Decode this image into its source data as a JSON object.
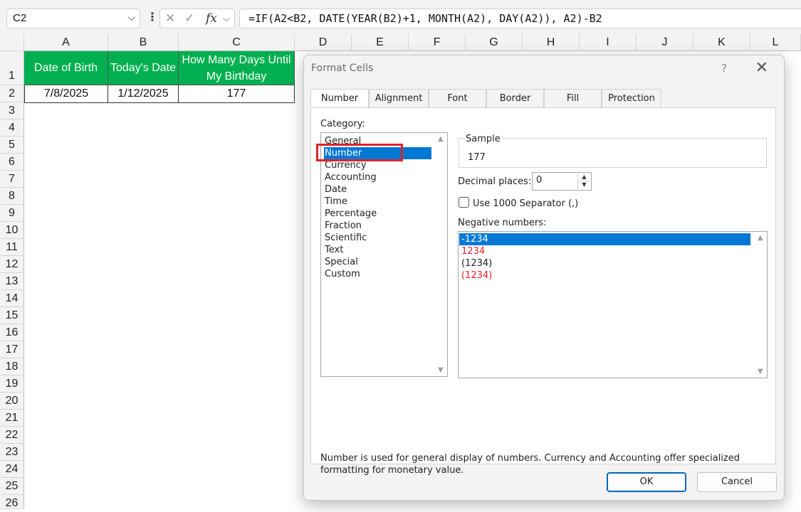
{
  "formula_bar": {
    "name_box": "C2",
    "formula": "=IF(A2<B2, DATE(YEAR(B2)+1, MONTH(A2), DAY(A2)), A2)-B2",
    "cancel_icon": "✕",
    "enter_icon": "✓",
    "fx_label": "fx"
  },
  "sheet": {
    "columns": [
      "A",
      "B",
      "C",
      "D",
      "E",
      "F",
      "G",
      "H",
      "I",
      "J",
      "K",
      "L"
    ],
    "rows": [
      "1",
      "2",
      "3",
      "4",
      "5",
      "6",
      "7",
      "8",
      "9",
      "10",
      "11",
      "12",
      "13",
      "14",
      "15",
      "16",
      "17",
      "18",
      "19",
      "20",
      "21",
      "22",
      "23",
      "24",
      "25",
      "26"
    ],
    "header_row": [
      "Date of Birth",
      "Today's Date",
      "How Many Days Until My Birthday"
    ],
    "data_row": [
      "7/8/2025",
      "1/12/2025",
      "177"
    ],
    "header_fill": "#00b050"
  },
  "dialog": {
    "title": "Format Cells",
    "help": "?",
    "close": "✕",
    "tabs": [
      "Number",
      "Alignment",
      "Font",
      "Border",
      "Fill",
      "Protection"
    ],
    "active_tab": "Number",
    "category_label": "Category:",
    "categories": [
      "General",
      "Number",
      "Currency",
      "Accounting",
      "Date",
      "Time",
      "Percentage",
      "Fraction",
      "Scientific",
      "Text",
      "Special",
      "Custom"
    ],
    "selected_category": "Number",
    "sample_label": "Sample",
    "sample_value": "177",
    "decimal_label": "Decimal places:",
    "decimal_value": "0",
    "separator_label": "Use 1000 Separator (,)",
    "negative_label": "Negative numbers:",
    "negative_options": [
      "-1234",
      "1234",
      "(1234)",
      "(1234)"
    ],
    "description": "Number is used for general display of numbers.  Currency and Accounting offer specialized formatting for monetary value.",
    "ok": "OK",
    "cancel": "Cancel",
    "accent": "#0078d4",
    "negative_red": "#e3202b"
  }
}
